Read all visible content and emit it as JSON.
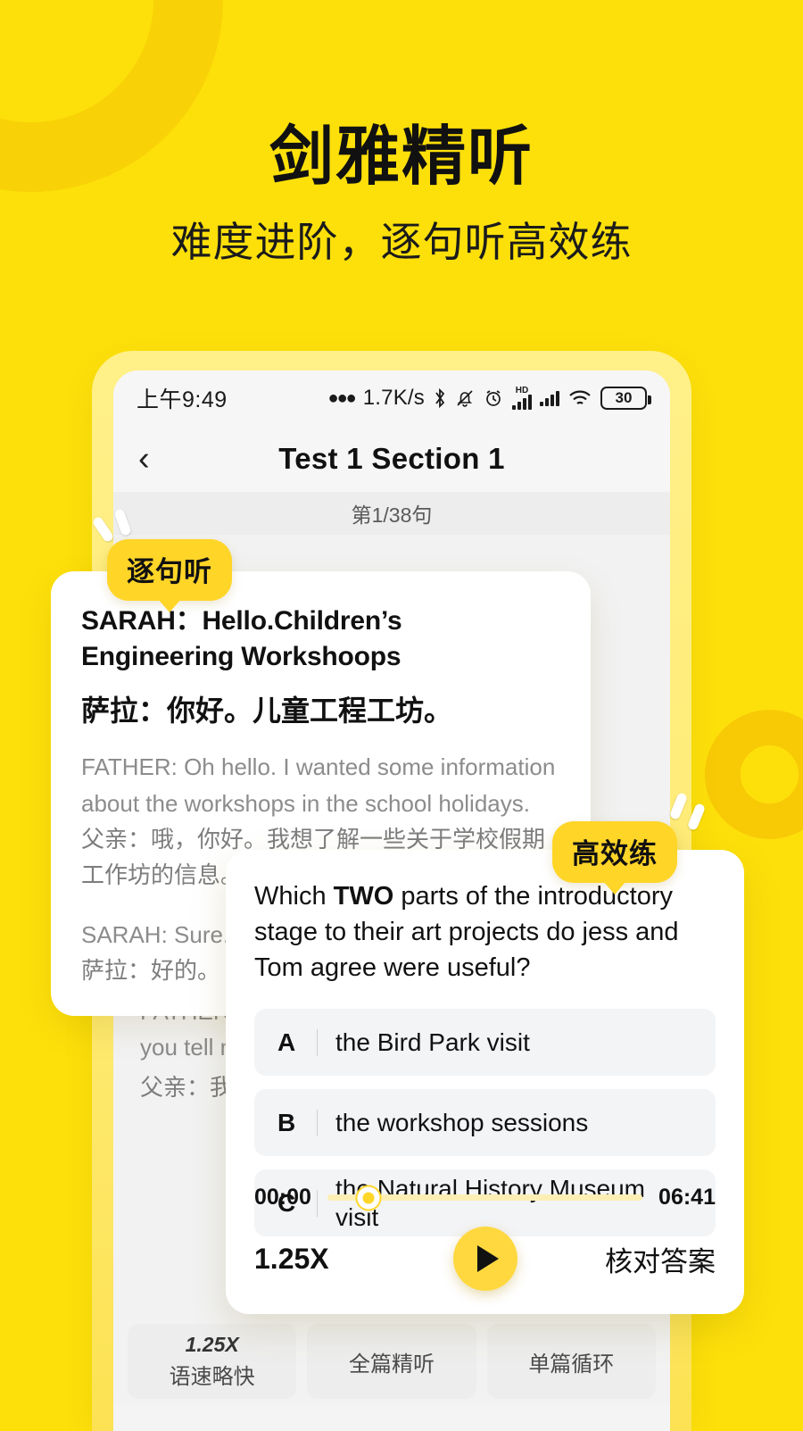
{
  "hero": {
    "title": "剑雅精听",
    "subtitle": "难度进阶，逐句听高效练"
  },
  "statusbar": {
    "time": "上午9:49",
    "dots": "●●●",
    "net_speed": "1.7K/s",
    "bluetooth_icon": "bluetooth-icon",
    "mute_icon": "bell-muted-icon",
    "alarm_icon": "alarm-clock-icon",
    "hd_label": "HD",
    "wifi_icon": "wifi-icon",
    "battery_level": "30"
  },
  "navbar": {
    "back_icon": "chevron-left-icon",
    "title": "Test 1 Section 1",
    "sentence_counter": "第1/38句"
  },
  "badges": {
    "sentence_mode": "逐句听",
    "practice_mode": "高效练"
  },
  "transcript_card": {
    "highlight_en": "SARAH：Hello.Children’s Engineering Workshoops",
    "highlight_zh": "萨拉：你好。儿童工程工坊。",
    "lines": [
      {
        "en": "FATHER: Oh hello. I wanted some information about the workshops in the school holidays.",
        "zh": "父亲：哦，你好。我想了解一些关于学校假期工作坊的信息。"
      },
      {
        "en": "SARAH: Sure.",
        "zh": "萨拉：好的。"
      }
    ]
  },
  "transcript_background": {
    "lines": [
      {
        "en": "FATHER: I'm interested in the one for four — can you tell me about that?",
        "zh": "父亲：我对四岁的那个感兴趣——"
      }
    ]
  },
  "question_card": {
    "prompt_before": "Which ",
    "prompt_bold": "TWO",
    "prompt_after": " parts of the introductory stage to their art projects do jess and Tom agree were useful?",
    "options": [
      {
        "letter": "A",
        "text": "the Bird Park visit"
      },
      {
        "letter": "B",
        "text": "the workshop sessions"
      },
      {
        "letter": "C",
        "text": "the Natural  History Museum visit"
      }
    ],
    "player": {
      "current_time": "00:00",
      "total_time": "06:41",
      "progress_percent": 13,
      "speed_label": "1.25X",
      "play_icon": "play-icon",
      "check_answer_label": "核对答案"
    }
  },
  "phone_tabs": [
    {
      "top": "1.25X",
      "label": "语速略快"
    },
    {
      "top": "",
      "label": "全篇精听"
    },
    {
      "top": "",
      "label": "单篇循环"
    }
  ],
  "colors": {
    "brand_yellow": "#FDE00A",
    "badge_yellow": "#FFD528",
    "accent_play": "#FFD83F"
  }
}
